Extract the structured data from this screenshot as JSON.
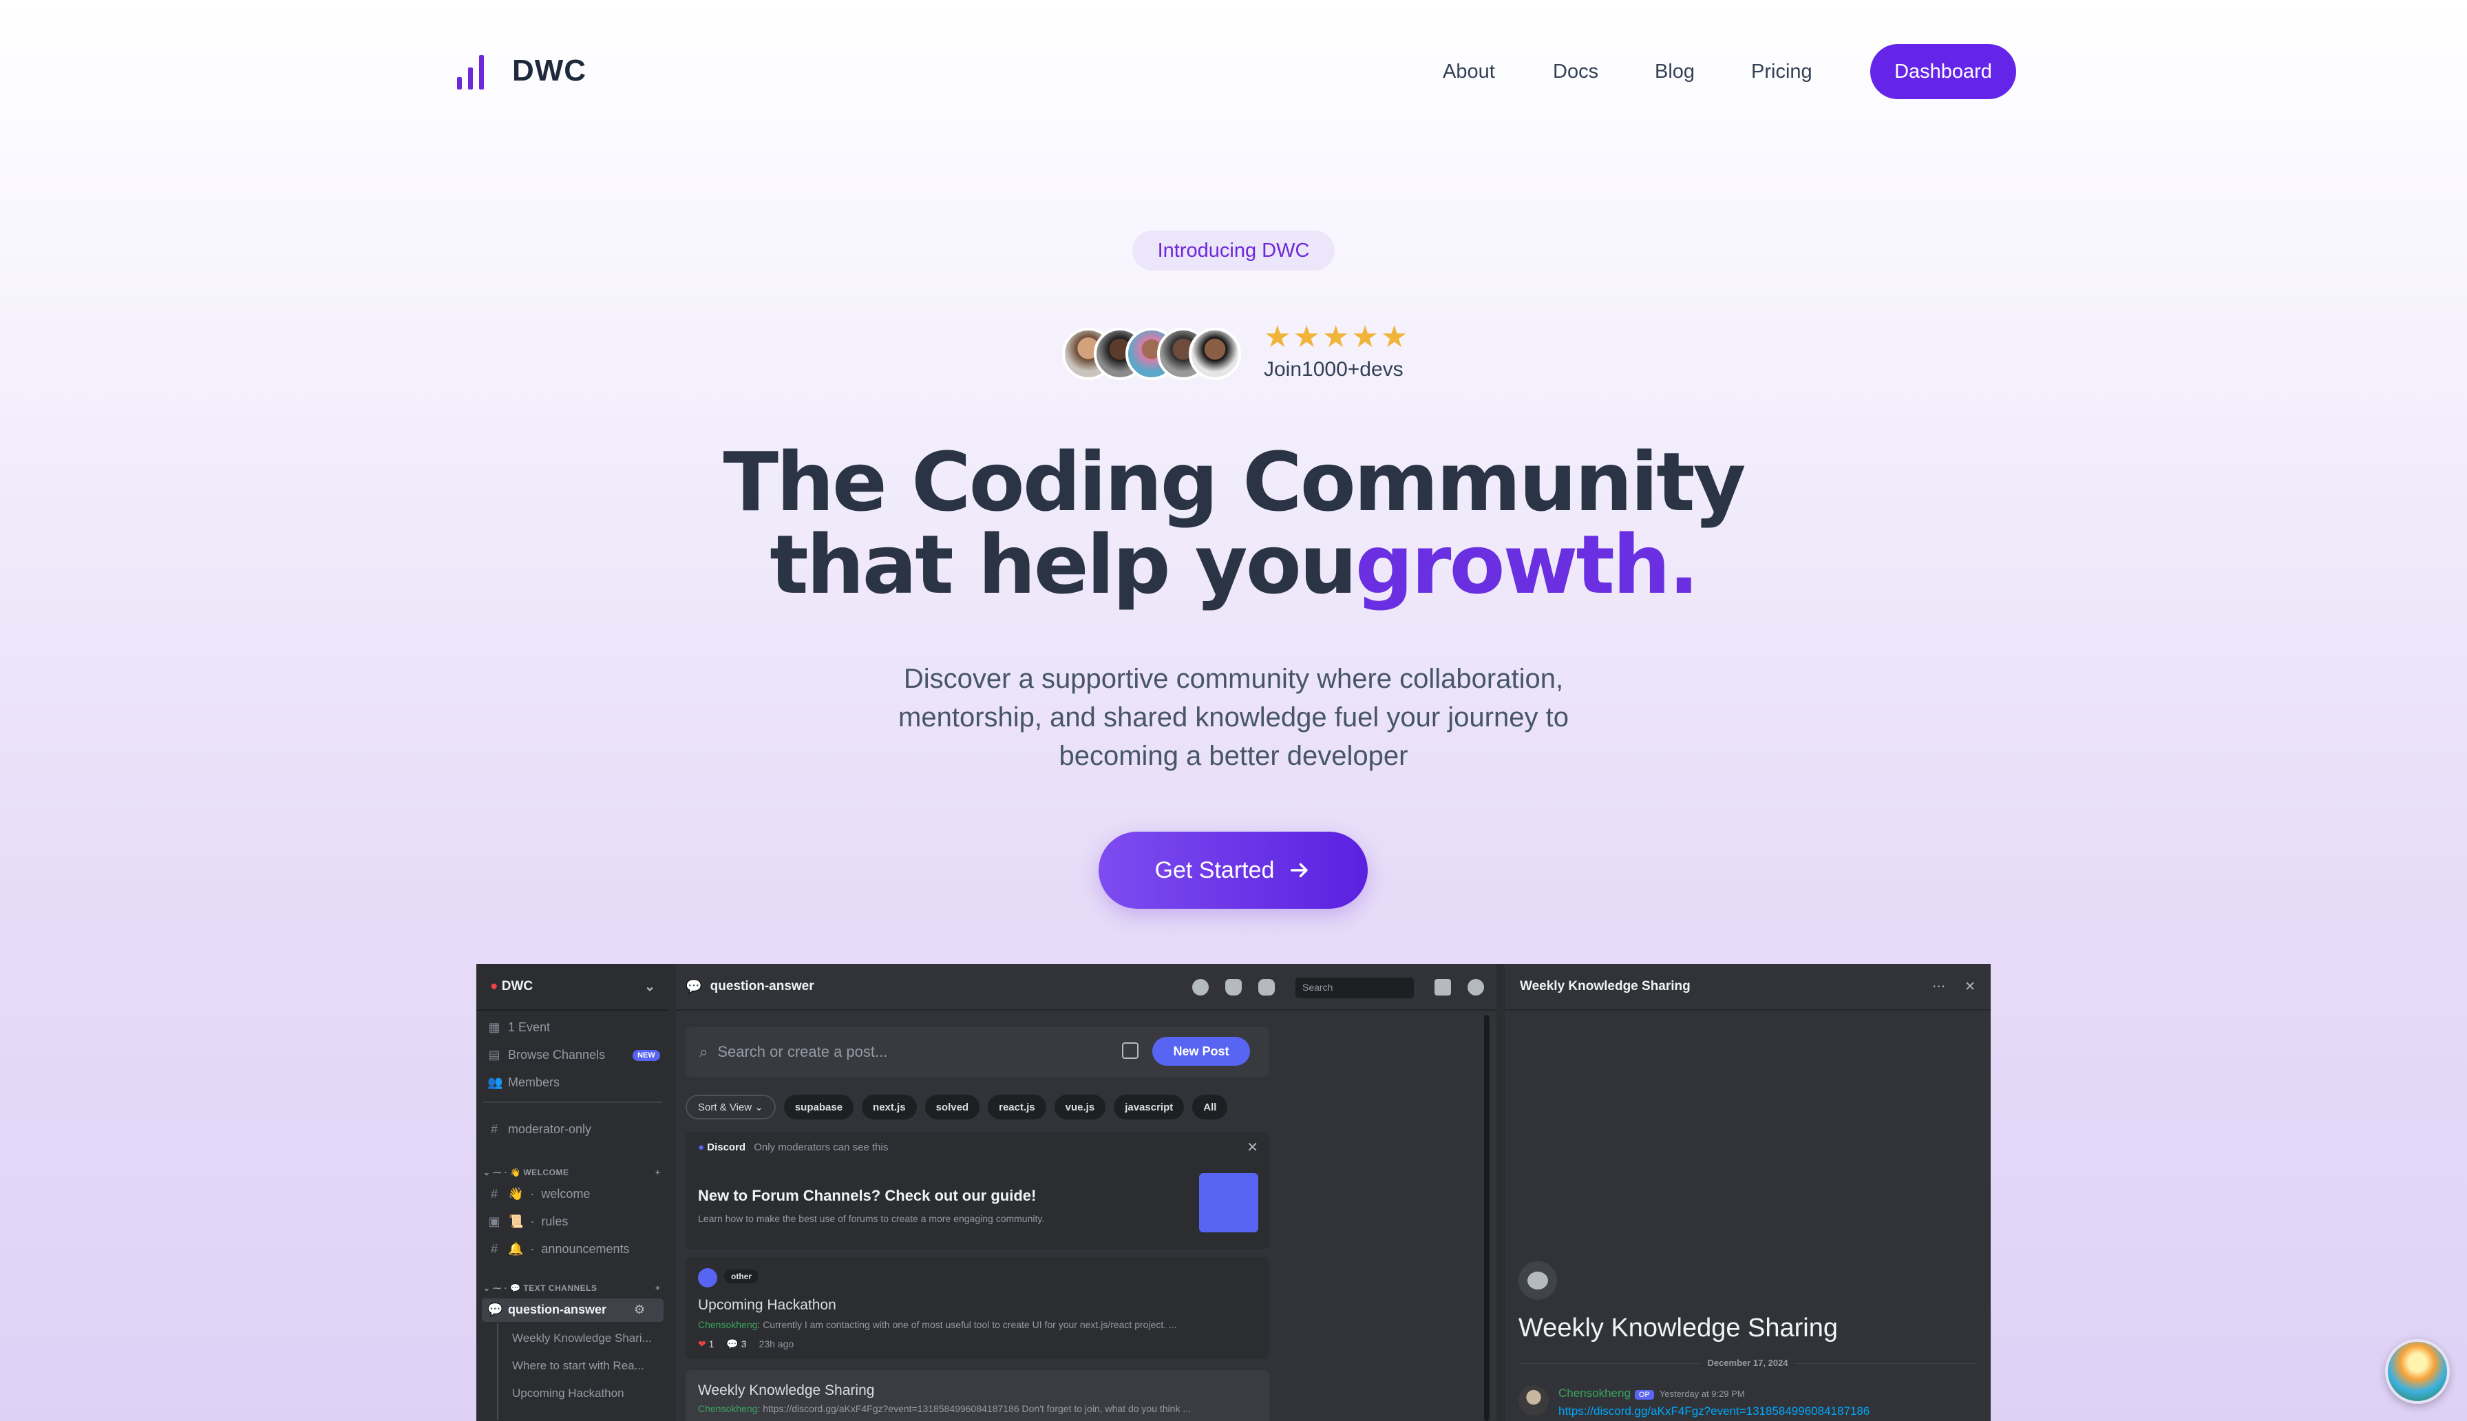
{
  "brand": {
    "name": "DWC"
  },
  "nav": {
    "items": [
      "About",
      "Docs",
      "Blog",
      "Pricing"
    ],
    "cta": "Dashboard"
  },
  "hero": {
    "badge": "Introducing DWC",
    "rating_stars": 5,
    "join_text": "Join1000+devs",
    "title_line1": "The Coding Community",
    "title_line2_a": "that help you",
    "title_line2_b": "growth.",
    "subtitle": "Discover a supportive community where collaboration, mentorship, and shared knowledge fuel your journey to becoming a better developer",
    "cta": "Get Started"
  },
  "app": {
    "server_name": "DWC",
    "sidebar": {
      "top_items": [
        "1 Event",
        "Browse Channels",
        "Members"
      ],
      "new_pill": "NEW",
      "moderator": "moderator-only",
      "welcome_category": "WELCOME",
      "welcome_channels": [
        "welcome",
        "rules",
        "announcements"
      ],
      "text_category": "TEXT CHANNELS",
      "active_channel": "question-answer",
      "threads": [
        "Weekly Knowledge Shari...",
        "Where to start with Rea...",
        "Upcoming Hackathon"
      ]
    },
    "channel": {
      "name": "question-answer",
      "search_placeholder": "Search",
      "post_placeholder": "Search or create a post...",
      "new_post": "New Post",
      "sort_label": "Sort & View",
      "tags": [
        "supabase",
        "next.js",
        "solved",
        "react.js",
        "vue.js",
        "javascript",
        "All"
      ],
      "guide": {
        "source": "Discord",
        "notice": "Only moderators can see this",
        "title": "New to Forum Channels? Check out our guide!",
        "desc": "Learn how to make the best use of forums to create a more engaging community."
      },
      "posts": [
        {
          "tag": "other",
          "title": "Upcoming Hackathon",
          "author": "Chensokheng",
          "preview": "Currently I am contacting with one of most useful tool to create UI for your next.js/react project. ...",
          "reactions": "1",
          "replies": "3",
          "time": "23h ago"
        },
        {
          "title": "Weekly Knowledge Sharing",
          "author": "Chensokheng",
          "preview": "https://discord.gg/aKxF4Fgz?event=1318584996084187186 Don't forget to join, what do you think ..."
        }
      ]
    },
    "thread": {
      "header": "Weekly Knowledge Sharing",
      "title": "Weekly Knowledge Sharing",
      "date": "December 17, 2024",
      "author": "Chensokheng",
      "op": "OP",
      "time": "Yesterday at 9:29 PM",
      "link": "https://discord.gg/aKxF4Fgz?event=1318584996084187186"
    }
  },
  "colors": {
    "accent": "#6425e8",
    "accent_text": "#6a2fe0",
    "discord_bg": "#313338",
    "star": "#f0b43a"
  }
}
